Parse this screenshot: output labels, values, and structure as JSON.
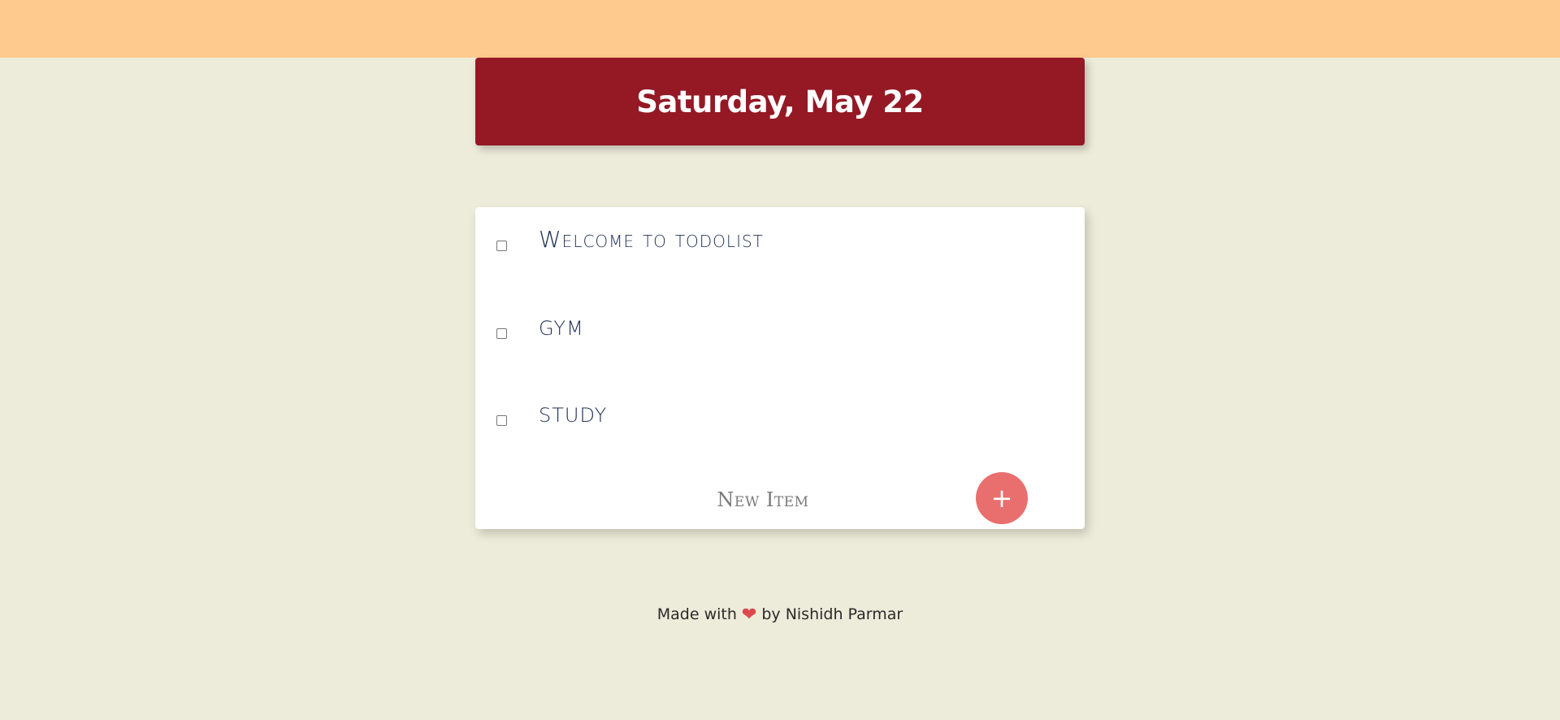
{
  "colors": {
    "top_band": "#FFCA8D",
    "background": "#EDECDA",
    "header_bg": "#941925",
    "card_bg": "#FFFFFF",
    "item_text": "#1F2F55",
    "add_button": "#E96F6F"
  },
  "header": {
    "title": "Saturday, May 22"
  },
  "todos": [
    {
      "label": "Welcome to todolist",
      "checked": false
    },
    {
      "label": "GYM",
      "checked": false
    },
    {
      "label": "STUDY",
      "checked": false
    }
  ],
  "new_item": {
    "placeholder": "New Item",
    "add_label": "+"
  },
  "footer": {
    "prefix": "Made with",
    "icon": "heart-icon",
    "suffix": "by Nishidh Parmar"
  }
}
